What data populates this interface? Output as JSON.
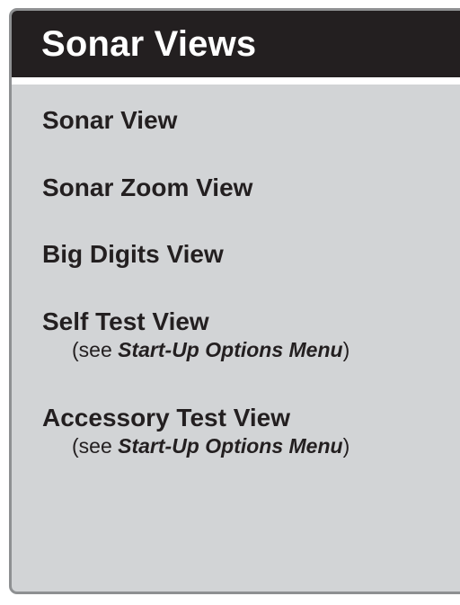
{
  "panel": {
    "title": "Sonar Views",
    "items": [
      {
        "label": "Sonar View"
      },
      {
        "label": "Sonar Zoom View"
      },
      {
        "label": "Big Digits View"
      },
      {
        "label": "Self Test View",
        "note": {
          "prefix": "(see ",
          "ref": "Start-Up Options Menu",
          "suffix": ")"
        }
      },
      {
        "label": "Accessory Test View",
        "note": {
          "prefix": "(see ",
          "ref": "Start-Up Options Menu",
          "suffix": ")"
        }
      }
    ]
  },
  "colors": {
    "panel_background": "#d2d4d6",
    "panel_border": "#8e9092",
    "header_background": "#231f20",
    "header_text": "#ffffff",
    "body_text": "#231f20"
  }
}
